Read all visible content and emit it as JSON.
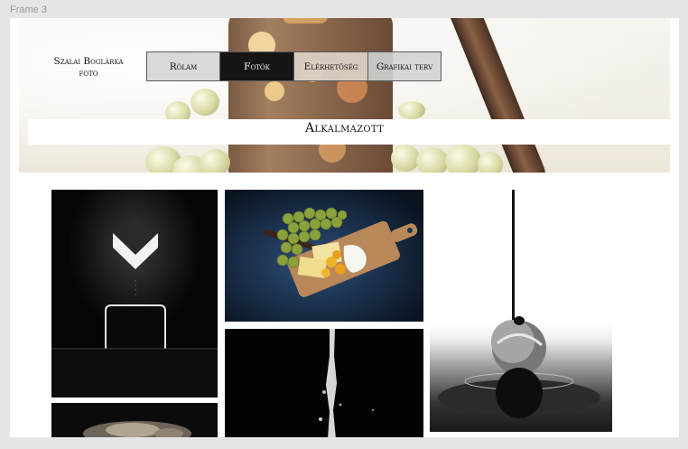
{
  "frame": {
    "label": "Frame 3"
  },
  "brand": {
    "line1": "Szalai Boglárka",
    "line2": "foto"
  },
  "nav": [
    {
      "label": "Rólam",
      "active": false
    },
    {
      "label": "Fotók",
      "active": true
    },
    {
      "label": "Elérhetőség",
      "active": false
    },
    {
      "label": "Grafikai terv",
      "active": false
    }
  ],
  "page": {
    "title": "Alkalmazott"
  },
  "colors": {
    "active_nav": "#151515",
    "page_bg": "#ffffff",
    "canvas_bg": "#e5e5e5"
  },
  "gallery": [
    {
      "subject": "dark-arrow-cube-photo"
    },
    {
      "subject": "grapes-cheese-board-photo"
    },
    {
      "subject": "drop-on-grape-photo"
    },
    {
      "subject": "dark-food-photo"
    },
    {
      "subject": "liquid-splash-photo"
    }
  ]
}
